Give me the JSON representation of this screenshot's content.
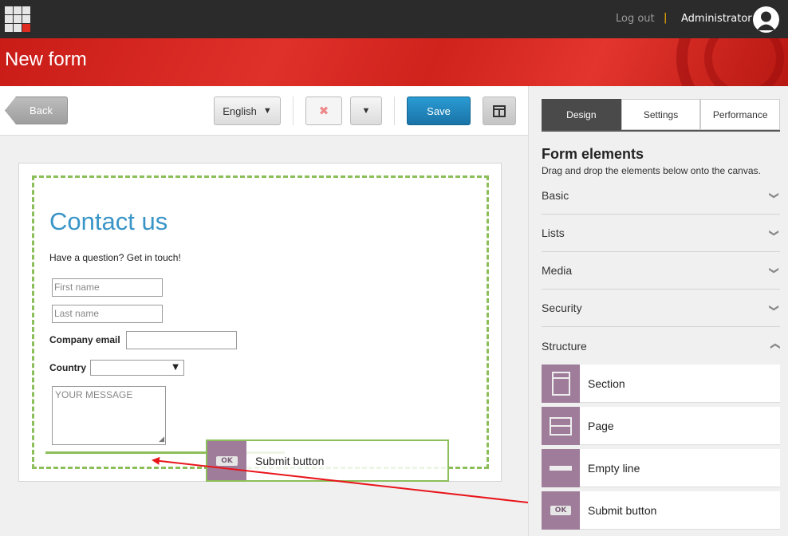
{
  "topbar": {
    "logout": "Log out",
    "separator": "|",
    "user": "Administrator"
  },
  "header": {
    "title": "New form"
  },
  "toolbar": {
    "back": "Back",
    "language": "English",
    "save": "Save"
  },
  "form": {
    "title": "Contact us",
    "subtitle": "Have a question? Get in touch!",
    "first_name_placeholder": "First name",
    "last_name_placeholder": "Last name",
    "company_email_label": "Company email",
    "country_label": "Country",
    "message_placeholder": "YOUR MESSAGE"
  },
  "dragging": {
    "badge": "OK",
    "label": "Submit button"
  },
  "panel": {
    "tabs": [
      "Design",
      "Settings",
      "Performance"
    ],
    "active_tab": "Design",
    "title": "Form elements",
    "description": "Drag and drop the elements below onto the canvas.",
    "sections": [
      "Basic",
      "Lists",
      "Media",
      "Security",
      "Structure"
    ],
    "structure_items": [
      "Section",
      "Page",
      "Empty line",
      "Submit button"
    ],
    "ok_badge": "OK"
  },
  "colors": {
    "accent_red": "#e02b20",
    "save_blue": "#1a74a8",
    "tile_purple": "#9f7d9a",
    "drop_green": "#8cbe5a",
    "title_blue": "#3a95c7"
  }
}
